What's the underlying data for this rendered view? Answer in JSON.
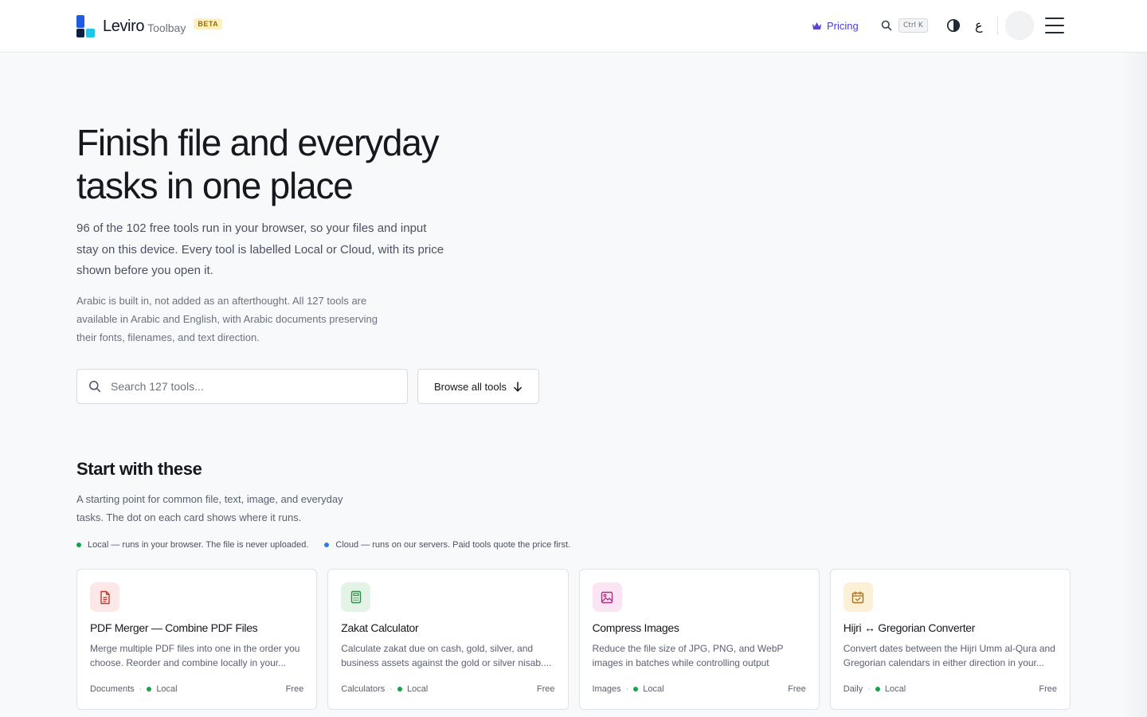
{
  "header": {
    "brand_name": "Leviro",
    "brand_sub": "Toolbay",
    "beta": "BETA",
    "pricing_label": "Pricing",
    "search_shortcut": "Ctrl K",
    "lang_toggle": "ع"
  },
  "hero": {
    "title_line1": "Finish file and everyday",
    "title_line2": "tasks in one place",
    "lead": "96 of the 102 free tools run in your browser, so your files and input stay on this device. Every tool is labelled Local or Cloud, with its price shown before you open it.",
    "arabic_note": "Arabic is built in, not added as an afterthought. All 127 tools are available in Arabic and English, with Arabic documents preserving their fonts, filenames, and text direction.",
    "search_placeholder": "Search 127 tools...",
    "browse_label": "Browse all tools"
  },
  "section": {
    "title": "Start with these",
    "desc": "A starting point for common file, text, image, and everyday tasks. The dot on each card shows where it runs.",
    "legend": [
      {
        "label": "Local — runs in your browser. The file is never uploaded.",
        "color": "#16a34a"
      },
      {
        "label": "Cloud — runs on our servers. Paid tools quote the price first.",
        "color": "#2b7de9"
      }
    ]
  },
  "cards": [
    {
      "title": "PDF Merger — Combine PDF Files",
      "desc": "Merge multiple PDF files into one in the order you choose. Reorder and combine locally in your...",
      "category": "Documents",
      "runs": "Local",
      "price": "Free",
      "icon": "document-icon",
      "icon_bg": "#fde7e7",
      "icon_color": "#c0392b"
    },
    {
      "title": "Zakat Calculator",
      "desc": "Calculate zakat due on cash, gold, silver, and business assets against the gold or silver nisab....",
      "category": "Calculators",
      "runs": "Local",
      "price": "Free",
      "icon": "calculator-icon",
      "icon_bg": "#e3f4e6",
      "icon_color": "#2e8b46"
    },
    {
      "title": "Compress Images",
      "desc": "Reduce the file size of JPG, PNG, and WebP images in batches while controlling output quality....",
      "category": "Images",
      "runs": "Local",
      "price": "Free",
      "icon": "image-icon",
      "icon_bg": "#fbe4f3",
      "icon_color": "#a8327f"
    },
    {
      "title": "Hijri ↔ Gregorian Converter",
      "desc": "Convert dates between the Hijri Umm al-Qura and Gregorian calendars in either direction in your...",
      "category": "Daily",
      "runs": "Local",
      "price": "Free",
      "icon": "calendar-icon",
      "icon_bg": "#fcf0d6",
      "icon_color": "#a9741a"
    }
  ],
  "colors": {
    "local_dot": "#16a34a",
    "cloud_dot": "#2b7de9",
    "accent": "#4b3fd6"
  }
}
